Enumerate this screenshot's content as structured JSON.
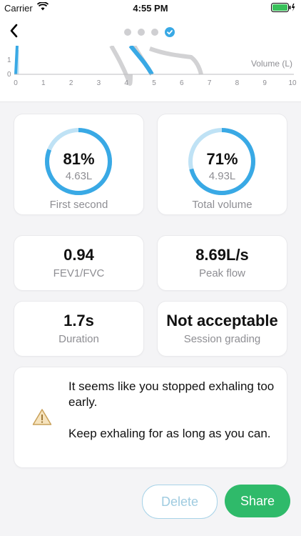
{
  "status_bar": {
    "carrier": "Carrier",
    "time": "4:55 PM"
  },
  "stepper": {
    "total": 4,
    "current": 4
  },
  "chart_data": {
    "type": "line",
    "xlabel": "Volume (L)",
    "x_ticks": [
      "0",
      "1",
      "2",
      "3",
      "4",
      "5",
      "6",
      "7",
      "8",
      "9",
      "10"
    ],
    "y_ticks_visible": [
      "1",
      "0"
    ],
    "xlim": [
      0,
      10
    ],
    "grid": false
  },
  "cards": {
    "first_second": {
      "percent": "81%",
      "volume": "4.63L",
      "label": "First second",
      "fraction": 0.81
    },
    "total_volume": {
      "percent": "71%",
      "volume": "4.93L",
      "label": "Total volume",
      "fraction": 0.71
    },
    "fev1_fvc": {
      "value": "0.94",
      "label": "FEV1/FVC"
    },
    "peak_flow": {
      "value": "8.69L/s",
      "label": "Peak flow"
    },
    "duration": {
      "value": "1.7s",
      "label": "Duration"
    },
    "grading": {
      "value": "Not acceptable",
      "label": "Session grading"
    }
  },
  "warning": {
    "line1": "It seems like you stopped exhaling too early.",
    "line2": "Keep exhaling for as long as you can."
  },
  "buttons": {
    "delete": "Delete",
    "share": "Share"
  },
  "colors": {
    "accent": "#39a9e5",
    "ring_track": "#bfe2f5",
    "share": "#2fba6a",
    "warning": "#c9a15a"
  }
}
